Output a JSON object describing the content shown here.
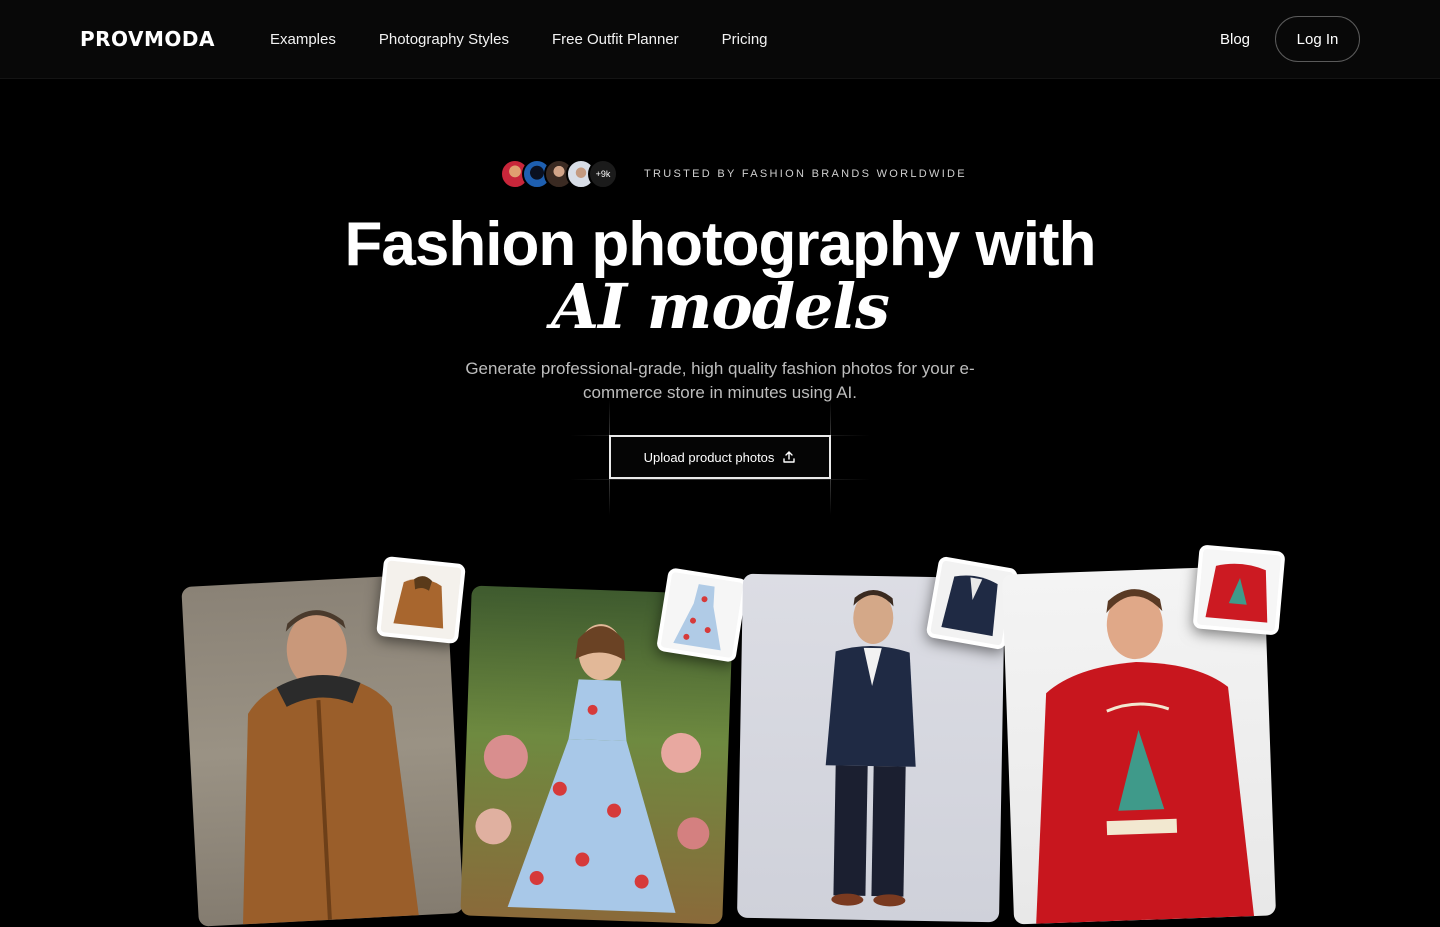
{
  "nav": {
    "logo": "PROVMODA",
    "links": [
      "Examples",
      "Photography Styles",
      "Free Outfit Planner",
      "Pricing"
    ],
    "blog": "Blog",
    "login": "Log In"
  },
  "hero": {
    "trusted_count": "+9k",
    "trusted_text": "TRUSTED BY FASHION BRANDS WORLDWIDE",
    "title_line1": "Fashion photography with",
    "title_line2": "AI models",
    "subtitle": "Generate professional-grade, high quality fashion photos for your e-commerce store in minutes using AI.",
    "cta": "Upload product photos",
    "cta_icon": "upload-icon"
  },
  "showcase": {
    "cards": [
      "jacket-model",
      "floral-dress-model",
      "suit-model",
      "christmas-sweater-model"
    ]
  },
  "colors": {
    "background": "#000000",
    "nav_background": "#080808",
    "text": "#ffffff",
    "muted": "#bdbdbd"
  }
}
